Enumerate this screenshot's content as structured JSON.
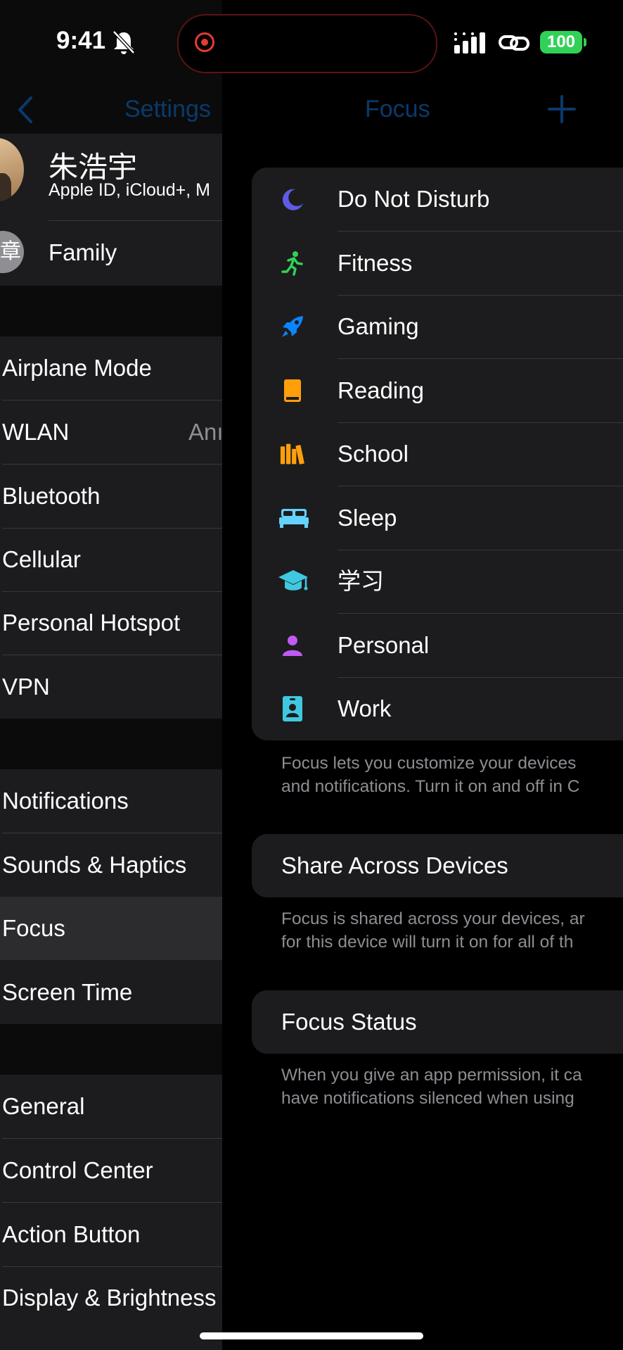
{
  "status_bar": {
    "time": "9:41",
    "battery": "100"
  },
  "left_nav": {
    "back_title": "Settings"
  },
  "right_nav": {
    "title": "Focus",
    "add": "+"
  },
  "profile": {
    "name": "朱浩宇",
    "subtitle": "Apple ID, iCloud+, M",
    "avatar_char": "章",
    "family": "Family"
  },
  "settings_groups": [
    {
      "items": [
        {
          "label": "Airplane Mode"
        },
        {
          "label": "WLAN",
          "value": "Anı"
        },
        {
          "label": "Bluetooth"
        },
        {
          "label": "Cellular"
        },
        {
          "label": "Personal Hotspot"
        },
        {
          "label": "VPN"
        }
      ]
    },
    {
      "items": [
        {
          "label": "Notifications"
        },
        {
          "label": "Sounds & Haptics"
        },
        {
          "label": "Focus"
        },
        {
          "label": "Screen Time"
        }
      ]
    },
    {
      "items": [
        {
          "label": "General"
        },
        {
          "label": "Control Center"
        },
        {
          "label": "Action Button"
        },
        {
          "label": "Display & Brightness"
        }
      ]
    }
  ],
  "focus_modes": [
    {
      "label": "Do Not Disturb",
      "icon": "moon-icon",
      "color": "#5e5ce6"
    },
    {
      "label": "Fitness",
      "icon": "running-icon",
      "color": "#30d158"
    },
    {
      "label": "Gaming",
      "icon": "rocket-icon",
      "color": "#0a84ff"
    },
    {
      "label": "Reading",
      "icon": "book-icon",
      "color": "#ff9f0a"
    },
    {
      "label": "School",
      "icon": "books-icon",
      "color": "#ff9f0a"
    },
    {
      "label": "Sleep",
      "icon": "bed-icon",
      "color": "#64d2ff"
    },
    {
      "label": "学习",
      "icon": "graduation-cap-icon",
      "color": "#40c8e0"
    },
    {
      "label": "Personal",
      "icon": "person-icon",
      "color": "#bf5af2"
    },
    {
      "label": "Work",
      "icon": "id-badge-icon",
      "color": "#40c8e0"
    }
  ],
  "focus_footnote": {
    "line1": "Focus lets you customize your devices",
    "line2": "and notifications. Turn it on and off in C"
  },
  "share_across_devices": {
    "label": "Share Across Devices",
    "note_line1": "Focus is shared across your devices, ar",
    "note_line2": "for this device will turn it on for all of th"
  },
  "focus_status": {
    "label": "Focus Status",
    "note_line1": "When you give an app permission, it ca",
    "note_line2": "have notifications silenced when using"
  },
  "colors": {
    "accent": "#0a84ff",
    "cell_bg": "#1c1c1e",
    "separator": "#38383a"
  }
}
